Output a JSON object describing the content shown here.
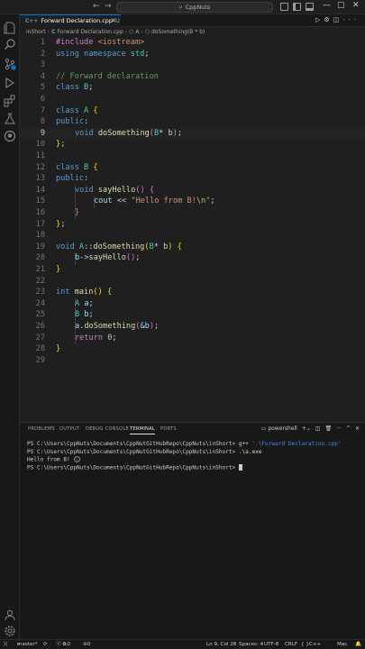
{
  "titlebar": {
    "search_text": "CppNuts",
    "back_glyph": "←",
    "forward_glyph": "→"
  },
  "tab": {
    "label": "Forward Declaration.cpp",
    "cpp_badge": "C++",
    "modified_badge": "U"
  },
  "breadcrumb": {
    "folder": "inShort",
    "file": "Forward Declaration.cpp",
    "class": "A",
    "method": "doSomething(B * b)"
  },
  "editor": {
    "active_line": 9,
    "lines": [
      {
        "n": "1"
      },
      {
        "n": "2"
      },
      {
        "n": "3"
      },
      {
        "n": "4"
      },
      {
        "n": "5"
      },
      {
        "n": "6"
      },
      {
        "n": "7"
      },
      {
        "n": "8"
      },
      {
        "n": "9"
      },
      {
        "n": "10"
      },
      {
        "n": "11"
      },
      {
        "n": "12"
      },
      {
        "n": "13"
      },
      {
        "n": "14"
      },
      {
        "n": "15"
      },
      {
        "n": "16"
      },
      {
        "n": "17"
      },
      {
        "n": "18"
      },
      {
        "n": "19"
      },
      {
        "n": "20"
      },
      {
        "n": "21"
      },
      {
        "n": "22"
      },
      {
        "n": "23"
      },
      {
        "n": "24"
      },
      {
        "n": "25"
      },
      {
        "n": "26"
      },
      {
        "n": "27"
      },
      {
        "n": "28"
      },
      {
        "n": "29"
      }
    ],
    "tokens": {
      "l1_a": "#include",
      "l1_b": " <iostream>",
      "l2_a": "using",
      "l2_b": " namespace",
      "l2_c": " std",
      "l2_d": ";",
      "l4": "// Forward declaration",
      "l5_a": "class",
      "l5_b": " B",
      "l5_c": ";",
      "l7_a": "class",
      "l7_b": " A",
      "l7_c": " {",
      "l8_a": "public",
      "l8_b": ":",
      "l9_a": "void",
      "l9_b": " doSomething",
      "l9_c": "(",
      "l9_d": "B",
      "l9_e": "* b",
      "l9_f": ")",
      "l9_g": ";",
      "l10_a": "}",
      "l10_b": ";",
      "l12_a": "class",
      "l12_b": " B",
      "l12_c": " {",
      "l13_a": "public",
      "l13_b": ":",
      "l14_a": "void",
      "l14_b": " sayHello",
      "l14_c": "()",
      "l14_d": " {",
      "l15_a": "cout",
      "l15_b": " << ",
      "l15_c": "\"Hello from B!",
      "l15_d": "\\n",
      "l15_e": "\"",
      "l15_f": ";",
      "l16": "}",
      "l17_a": "}",
      "l17_b": ";",
      "l19_a": "void",
      "l19_b": " A",
      "l19_c": "::",
      "l19_d": "doSomething",
      "l19_e": "(",
      "l19_f": "B",
      "l19_g": "* b",
      "l19_h": ")",
      "l19_i": " {",
      "l20_a": "b->",
      "l20_b": "sayHello",
      "l20_c": "()",
      "l20_d": ";",
      "l21": "}",
      "l23_a": "int",
      "l23_b": " main",
      "l23_c": "()",
      "l23_d": " {",
      "l24_a": "A",
      "l24_b": " a;",
      "l25_a": "B",
      "l25_b": " b;",
      "l26_a": "a.",
      "l26_b": "doSomething",
      "l26_c": "(",
      "l26_d": "&b",
      "l26_e": ")",
      "l26_f": ";",
      "l27_a": "return",
      "l27_b": " 0",
      "l27_c": ";",
      "l28": "}"
    }
  },
  "panel": {
    "tabs": [
      "PROBLEMS",
      "OUTPUT",
      "DEBUG CONSOLE",
      "TERMINAL",
      "PORTS"
    ],
    "active_tab": "TERMINAL",
    "shell": "powershell",
    "terminal": {
      "prompt": "PS C:\\Users\\CppNuts\\Documents\\CppNutGitHubRepo\\CppNuts\\inShort>",
      "cmd1": "g++",
      "cmd1_arg": "'.\\Forward Declaration.cpp'",
      "cmd2": ".\\a.exe",
      "output": "Hello from B!"
    }
  },
  "statusbar": {
    "branch": "master*",
    "errors": "0",
    "warnings": "0",
    "ports": "0",
    "position": "Ln 9, Col 28",
    "spaces": "Spaces: 4",
    "encoding": "UTF-8",
    "eol": "CRLF",
    "language": "C++",
    "platform": "Mac"
  },
  "colors": {
    "accent": "#0078d4",
    "keyword": "#569cd6",
    "control": "#c586c0",
    "type": "#4ec9b0",
    "function": "#dcdcaa",
    "string": "#ce9178",
    "comment": "#6a9955"
  }
}
